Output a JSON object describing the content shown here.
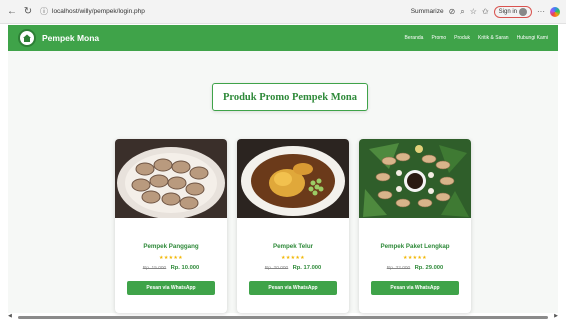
{
  "browser": {
    "url": "localhost/willy/pempek/login.php",
    "summarize_label": "Summarize",
    "signin_label": "Sign in"
  },
  "navbar": {
    "brand": "Pempek Mona",
    "menu": [
      "Beranda",
      "Promo",
      "Produk",
      "Kritik & Saran",
      "Hubungi Kami"
    ]
  },
  "page": {
    "title": "Produk Promo Pempek Mona"
  },
  "products": [
    {
      "name": "Pempek Panggang",
      "stars": "★★★★★",
      "old_price": "Rp. 15.000",
      "new_price": "Rp. 10.000",
      "button": "Pesan via WhatsApp"
    },
    {
      "name": "Pempek Telur",
      "stars": "★★★★★",
      "old_price": "Rp. 20.000",
      "new_price": "Rp. 17.000",
      "button": "Pesan via WhatsApp"
    },
    {
      "name": "Pempek Paket Lengkap",
      "stars": "★★★★★",
      "old_price": "Rp. 32.000",
      "new_price": "Rp. 29.000",
      "button": "Pesan via WhatsApp"
    }
  ],
  "colors": {
    "brand_green": "#3fa349",
    "star": "#f2b705"
  }
}
